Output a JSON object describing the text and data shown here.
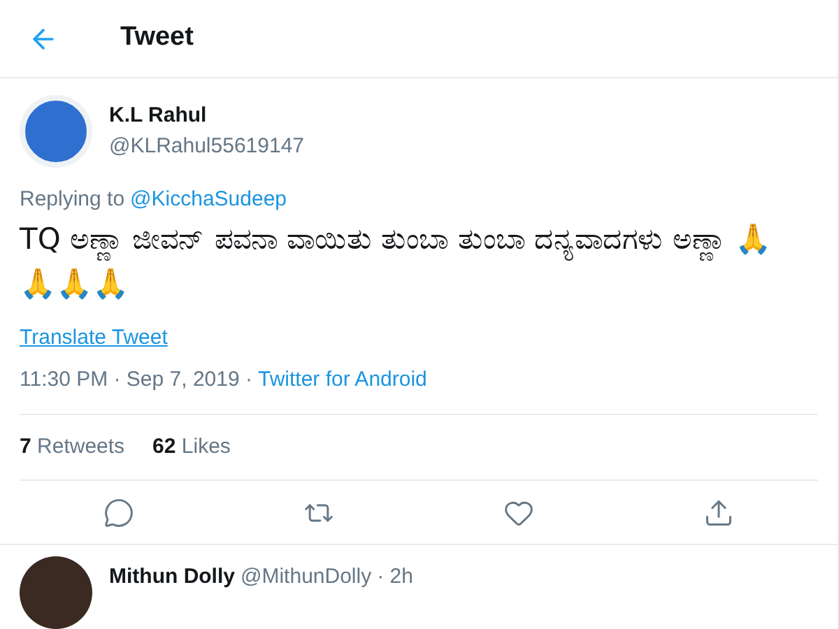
{
  "header": {
    "title": "Tweet"
  },
  "tweet": {
    "name": "K.L Rahul",
    "handle": "@KLRahul55619147",
    "replying_prefix": "Replying to",
    "replying_to": "@KicchaSudeep",
    "text": "TQ ಅಣ್ಣಾ ಜೀವನ್ ಪವನಾ ವಾಯಿತು ತುಂಬಾ ತುಂಬಾ ದನ್ಯವಾದಗಳು ಅಣ್ಣಾ 🙏🙏🙏🙏",
    "translate": "Translate Tweet",
    "timestamp": "11:30 PM · Sep 7, 2019 ·",
    "source": "Twitter for Android",
    "stats": [
      {
        "count": "7",
        "label": "Retweets"
      },
      {
        "count": "62",
        "label": "Likes"
      }
    ],
    "actions": [
      {
        "kind": "reply"
      },
      {
        "kind": "retweet"
      },
      {
        "kind": "like"
      },
      {
        "kind": "share"
      }
    ]
  },
  "reply": {
    "name": "Mithun Dolly",
    "handle": "@MithunDolly",
    "time": "· 2h"
  }
}
